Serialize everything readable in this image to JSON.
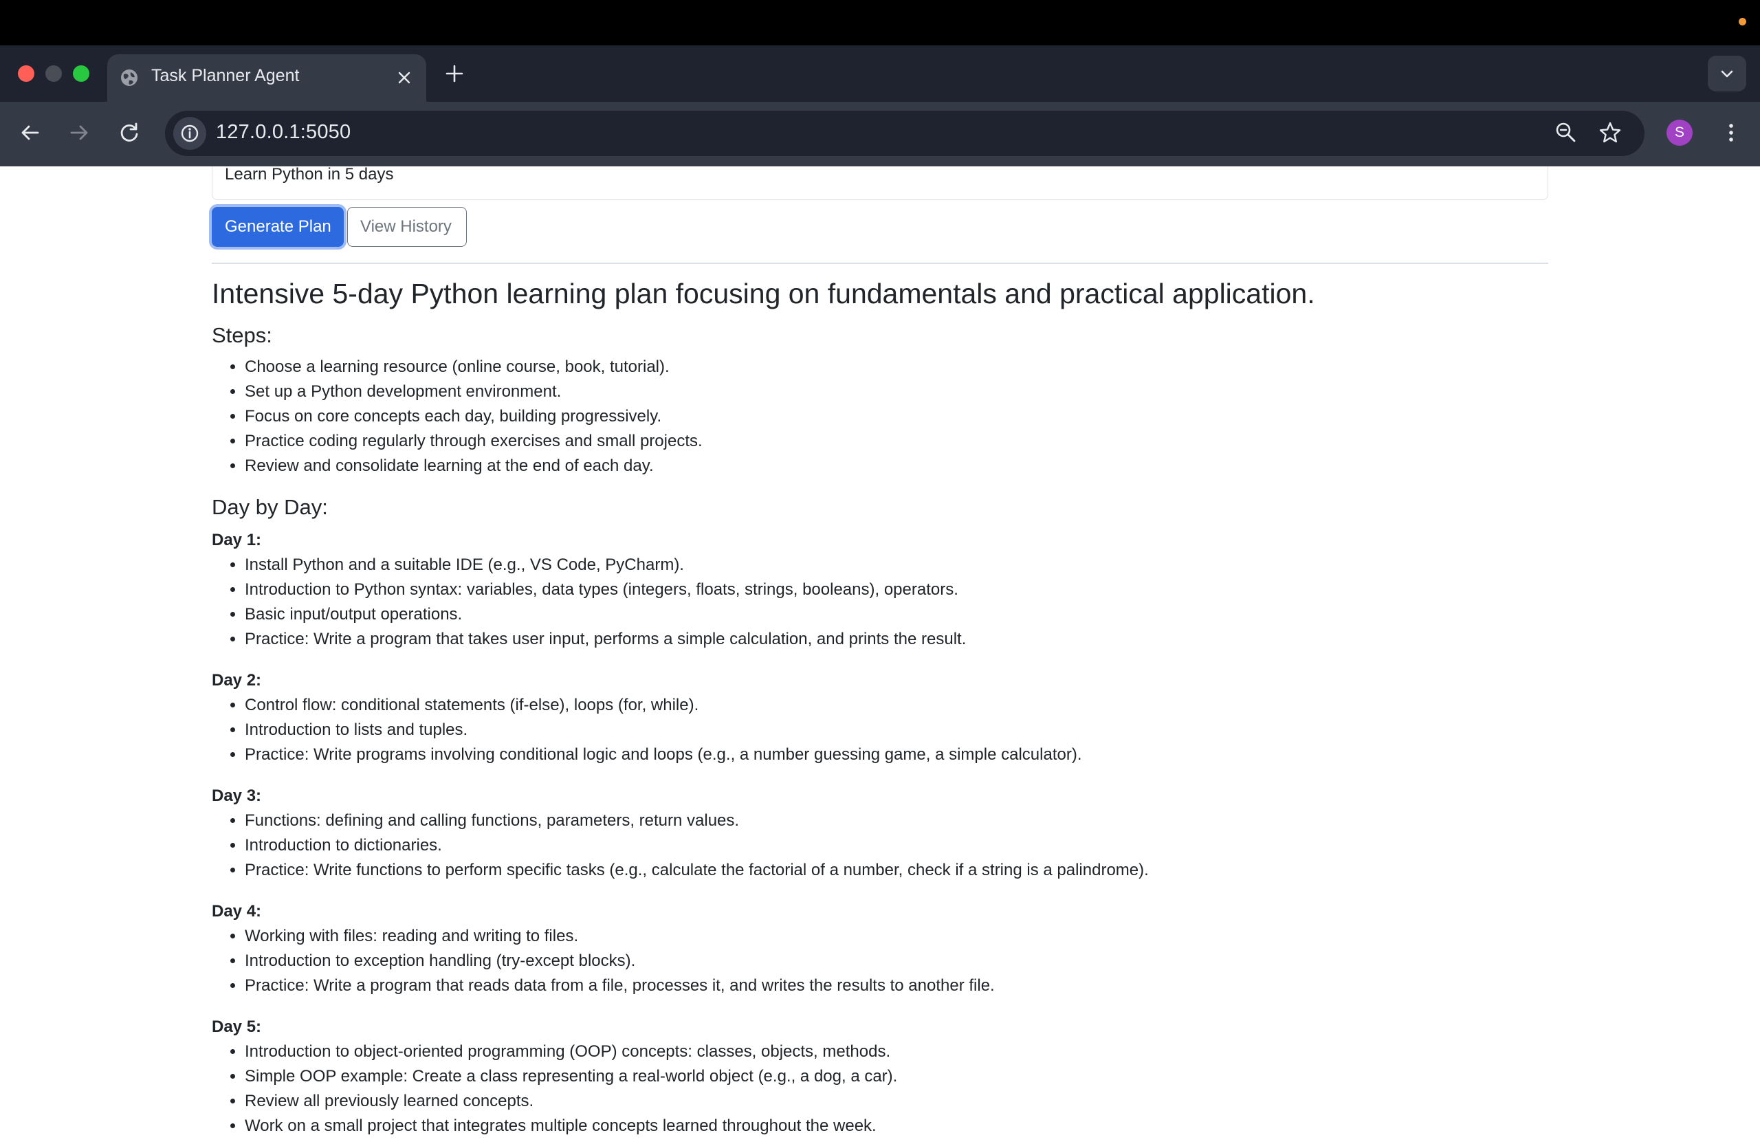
{
  "browser": {
    "tab_title": "Task Planner Agent",
    "url": "127.0.0.1:5050",
    "avatar_letter": "S"
  },
  "form": {
    "task_value": "Learn Python in 5 days",
    "generate_label": "Generate Plan",
    "history_label": "View History"
  },
  "plan": {
    "title": "Intensive 5-day Python learning plan focusing on fundamentals and practical application.",
    "steps_heading": "Steps:",
    "steps": [
      "Choose a learning resource (online course, book, tutorial).",
      "Set up a Python development environment.",
      "Focus on core concepts each day, building progressively.",
      "Practice coding regularly through exercises and small projects.",
      "Review and consolidate learning at the end of each day."
    ],
    "day_heading": "Day by Day:",
    "days": [
      {
        "label": "Day 1:",
        "items": [
          "Install Python and a suitable IDE (e.g., VS Code, PyCharm).",
          "Introduction to Python syntax: variables, data types (integers, floats, strings, booleans), operators.",
          "Basic input/output operations.",
          "Practice: Write a program that takes user input, performs a simple calculation, and prints the result."
        ]
      },
      {
        "label": "Day 2:",
        "items": [
          "Control flow: conditional statements (if-else), loops (for, while).",
          "Introduction to lists and tuples.",
          "Practice: Write programs involving conditional logic and loops (e.g., a number guessing game, a simple calculator)."
        ]
      },
      {
        "label": "Day 3:",
        "items": [
          "Functions: defining and calling functions, parameters, return values.",
          "Introduction to dictionaries.",
          "Practice: Write functions to perform specific tasks (e.g., calculate the factorial of a number, check if a string is a palindrome)."
        ]
      },
      {
        "label": "Day 4:",
        "items": [
          "Working with files: reading and writing to files.",
          "Introduction to exception handling (try-except blocks).",
          "Practice: Write a program that reads data from a file, processes it, and writes the results to another file."
        ]
      },
      {
        "label": "Day 5:",
        "items": [
          "Introduction to object-oriented programming (OOP) concepts: classes, objects, methods.",
          "Simple OOP example: Create a class representing a real-world object (e.g., a dog, a car).",
          "Review all previously learned concepts.",
          "Work on a small project that integrates multiple concepts learned throughout the week."
        ]
      }
    ]
  },
  "colors": {
    "primary": "#2d6ae0",
    "browser_dark": "#1f2330",
    "toolbar": "#353a47"
  }
}
